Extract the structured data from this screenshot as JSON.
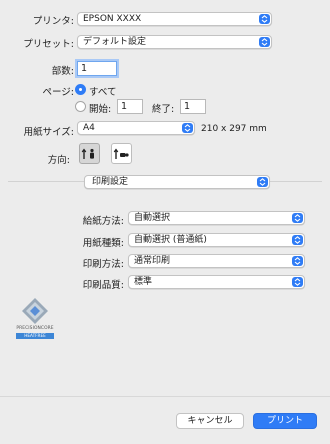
{
  "printer": {
    "label": "プリンタ:",
    "value": "EPSON XXXX"
  },
  "preset": {
    "label": "プリセット:",
    "value": "デフォルト設定"
  },
  "copies": {
    "label": "部数:",
    "value": "1"
  },
  "pages": {
    "label": "ページ:",
    "all_label": "すべて",
    "from_label": "開始:",
    "from_value": "1",
    "to_label": "終了:",
    "to_value": "1"
  },
  "paper_size": {
    "label": "用紙サイズ:",
    "value": "A4",
    "dimensions": "210 x 297 mm"
  },
  "orientation": {
    "label": "方向:",
    "selected": "portrait"
  },
  "section_popup": {
    "value": "印刷設定"
  },
  "settings": [
    {
      "label": "給紙方法:",
      "value": "自動選択"
    },
    {
      "label": "用紙種類:",
      "value": "自動選択 (普通紙)"
    },
    {
      "label": "印刷方法:",
      "value": "通常印刷"
    },
    {
      "label": "印刷品質:",
      "value": "標準"
    }
  ],
  "logo": {
    "line1": "PRECISIONCORE",
    "line2": "HEATFREE"
  },
  "buttons": {
    "cancel": "キャンセル",
    "print": "プリント"
  },
  "colors": {
    "accent": "#2f7cf6",
    "background": "#ececec"
  }
}
